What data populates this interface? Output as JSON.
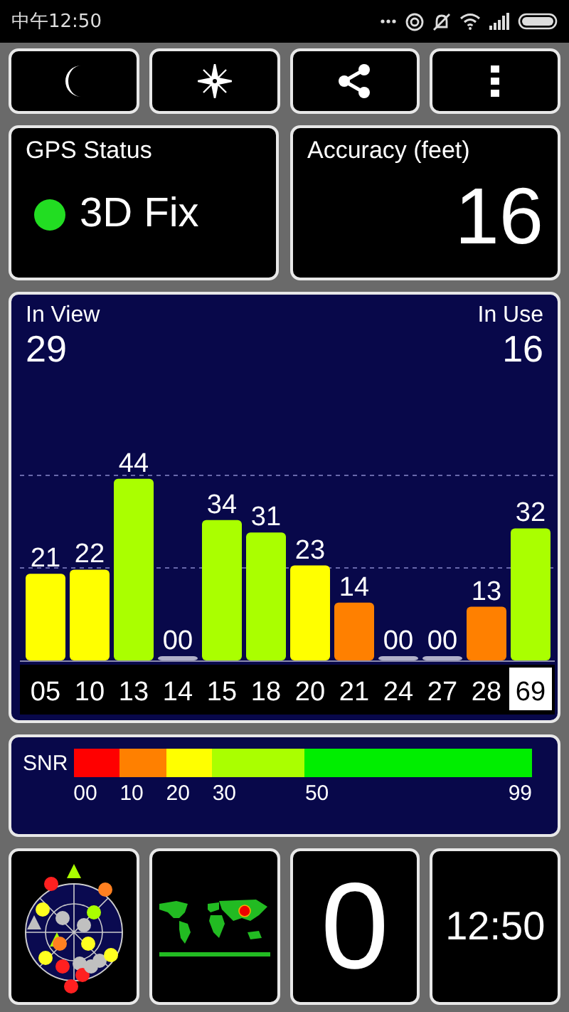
{
  "status_bar": {
    "time": "中午12:50"
  },
  "toolbar": [
    {
      "kind": "moon"
    },
    {
      "kind": "compass"
    },
    {
      "kind": "share"
    },
    {
      "kind": "more"
    }
  ],
  "gps_status": {
    "title": "GPS Status",
    "value": "3D Fix",
    "color": "#22dd22"
  },
  "accuracy": {
    "title": "Accuracy (feet)",
    "value": "16"
  },
  "satellites": {
    "in_view_label": "In View",
    "in_view": "29",
    "in_use_label": "In Use",
    "in_use": "16",
    "chart_data": {
      "type": "bar",
      "categories": [
        "05",
        "10",
        "13",
        "14",
        "15",
        "18",
        "20",
        "21",
        "24",
        "27",
        "28",
        "69"
      ],
      "values": [
        21,
        22,
        44,
        0,
        34,
        31,
        23,
        14,
        0,
        0,
        13,
        32
      ],
      "value_labels": [
        "21",
        "22",
        "44",
        "00",
        "34",
        "31",
        "23",
        "14",
        "00",
        "00",
        "13",
        "32"
      ]
    },
    "category_marks": [
      {
        "highlighted": false
      },
      {
        "highlighted": false
      },
      {
        "highlighted": false
      },
      {
        "highlighted": false
      },
      {
        "highlighted": false
      },
      {
        "highlighted": false
      },
      {
        "highlighted": false
      },
      {
        "highlighted": false
      },
      {
        "highlighted": false
      },
      {
        "highlighted": false
      },
      {
        "highlighted": false
      },
      {
        "highlighted": true
      }
    ]
  },
  "snr_scale": {
    "label": "SNR",
    "ticks": [
      "00",
      "10",
      "20",
      "30",
      "50",
      "99"
    ],
    "segments": [
      {
        "color": "#ff0000"
      },
      {
        "color": "#ff8000"
      },
      {
        "color": "#ffff00"
      },
      {
        "color": "#aaff00"
      },
      {
        "color": "#00ee00"
      }
    ]
  },
  "tiles": [
    {
      "kind": "skyplot"
    },
    {
      "kind": "map"
    },
    {
      "kind": "text",
      "value": "0"
    },
    {
      "kind": "clock",
      "value": "12:50"
    }
  ]
}
